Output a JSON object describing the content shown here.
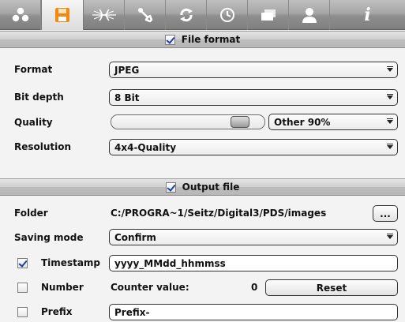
{
  "toolbar": {
    "items": [
      {
        "name": "shapes",
        "active": false
      },
      {
        "name": "save",
        "active": true
      },
      {
        "name": "lens",
        "active": false
      },
      {
        "name": "tools",
        "active": false
      },
      {
        "name": "refresh",
        "active": false
      },
      {
        "name": "clock",
        "active": false
      },
      {
        "name": "windows",
        "active": false
      },
      {
        "name": "user",
        "active": false
      },
      {
        "name": "info",
        "active": false
      }
    ],
    "info_glyph": "i",
    "save_color": "#f28a12"
  },
  "file_format": {
    "header": "File format",
    "enabled": true,
    "format_label": "Format",
    "format_value": "JPEG",
    "bit_depth_label": "Bit depth",
    "bit_depth_value": "8 Bit",
    "quality_label": "Quality",
    "quality_level_percent": 90,
    "quality_value": "Other 90%",
    "resolution_label": "Resolution",
    "resolution_value": "4x4-Quality"
  },
  "output_file": {
    "header": "Output file",
    "enabled": true,
    "folder_label": "Folder",
    "folder_value": "C:/PROGRA~1/Seitz/Digital3/PDS/images",
    "browse_label": "...",
    "saving_mode_label": "Saving mode",
    "saving_mode_value": "Confirm",
    "timestamp_checked": true,
    "timestamp_label": "Timestamp",
    "timestamp_value": "yyyy_MMdd_hhmmss",
    "number_checked": false,
    "number_label": "Number",
    "counter_label": "Counter value:",
    "counter_value": "0",
    "reset_label": "Reset",
    "prefix_checked": false,
    "prefix_label": "Prefix",
    "prefix_value": "Prefix-"
  }
}
